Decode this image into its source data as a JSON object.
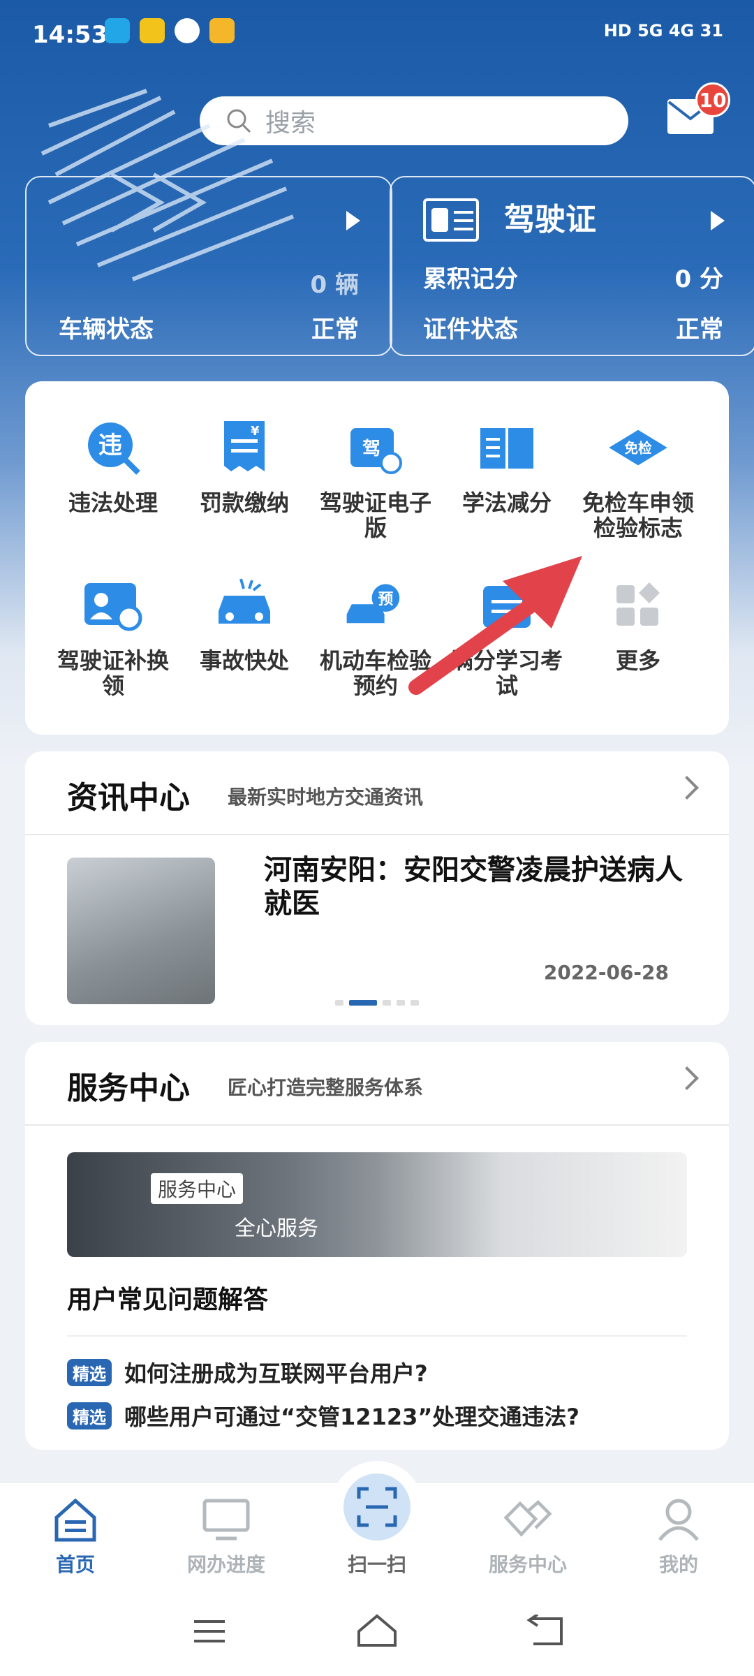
{
  "status": {
    "time": "14:53",
    "right": "HD 5G 4G 31"
  },
  "search": {
    "placeholder": "搜索"
  },
  "mail": {
    "badge": "10"
  },
  "vehicle_card": {
    "count_unit": "0 辆",
    "status_label": "车辆状态",
    "status_value": "正常"
  },
  "license_card": {
    "title": "驾驶证",
    "points_label": "累积记分",
    "points_value": "0 分",
    "status_label": "证件状态",
    "status_value": "正常"
  },
  "services": [
    {
      "label": "违法处理",
      "icon": "violation-icon"
    },
    {
      "label": "罚款缴纳",
      "icon": "fine-payment-icon"
    },
    {
      "label": "驾驶证电子版",
      "icon": "e-license-icon"
    },
    {
      "label": "学法减分",
      "icon": "study-book-icon"
    },
    {
      "label": "免检车申领检验标志",
      "icon": "inspection-exempt-icon"
    },
    {
      "label": "驾驶证补换领",
      "icon": "license-renew-icon"
    },
    {
      "label": "事故快处",
      "icon": "accident-car-icon"
    },
    {
      "label": "机动车检验预约",
      "icon": "inspection-booking-icon"
    },
    {
      "label": "满分学习考试",
      "icon": "exam-icon"
    },
    {
      "label": "更多",
      "icon": "more-grid-icon"
    }
  ],
  "news": {
    "title": "资讯中心",
    "subtitle": "最新实时地方交通资讯",
    "headline": "河南安阳：安阳交警凌晨护送病人就医",
    "date": "2022-06-28"
  },
  "service_center": {
    "title": "服务中心",
    "subtitle": "匠心打造完整服务体系",
    "banner_tag": "服务中心",
    "banner_sub": "全心服务",
    "faq_title": "用户常见问题解答",
    "faq_tag": "精选",
    "faq": [
      "如何注册成为互联网平台用户?",
      "哪些用户可通过“交管12123”处理交通违法?"
    ]
  },
  "tabs": [
    "首页",
    "网办进度",
    "扫一扫",
    "服务中心",
    "我的"
  ],
  "colors": {
    "primary": "#2a67b3",
    "badge": "#e8453c",
    "arrow": "#e2434b"
  }
}
